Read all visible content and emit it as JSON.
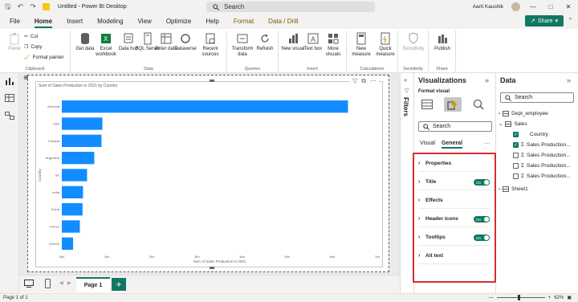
{
  "titlebar": {
    "doc_title": "Untitled - Power BI Desktop",
    "search_placeholder": "Search",
    "user_name": "Aarti Kaushik"
  },
  "menu": {
    "tabs": [
      "File",
      "Home",
      "Insert",
      "Modeling",
      "View",
      "Optimize",
      "Help",
      "Format",
      "Data / Drill"
    ],
    "active": "Home",
    "share_label": "Share"
  },
  "ribbon": {
    "clipboard": {
      "paste": "Paste",
      "cut": "Cut",
      "copy": "Copy",
      "format_painter": "Format painter",
      "group": "Clipboard"
    },
    "data": {
      "get_data": "Get data",
      "excel": "Excel workbook",
      "data_hub": "Data hub",
      "sql": "SQL Server",
      "enter_data": "Enter data",
      "dataverse": "Dataverse",
      "recent": "Recent sources",
      "group": "Data"
    },
    "queries": {
      "transform": "Transform data",
      "refresh": "Refresh",
      "group": "Queries"
    },
    "insert": {
      "new_visual": "New visual",
      "text_box": "Text box",
      "more_visuals": "More visuals",
      "group": "Insert"
    },
    "calculations": {
      "new_measure": "New measure",
      "quick_measure": "Quick measure",
      "group": "Calculations"
    },
    "sensitivity": {
      "label": "Sensitivity",
      "group": "Sensitivity"
    },
    "share": {
      "publish": "Publish",
      "group": "Share"
    }
  },
  "chart_data": {
    "type": "bar",
    "title": "Sum of Sales Production in 2021 by Country",
    "xlabel": "Sum of Sales Production in 2021",
    "ylabel": "Country",
    "categories": [
      "Armenia",
      "USA",
      "Canada",
      "Argentina",
      "UK",
      "India",
      "China",
      "France",
      "Greece"
    ],
    "values": [
      6.35,
      0.9,
      0.88,
      0.72,
      0.56,
      0.47,
      0.46,
      0.4,
      0.25
    ],
    "xlim": [
      0,
      7
    ],
    "xticks": [
      "0bn",
      "1bn",
      "2bn",
      "3bn",
      "4bn",
      "5bn",
      "6bn",
      "7bn"
    ],
    "bar_color": "#118DFF"
  },
  "pages": {
    "tab": "Page 1",
    "add": "+"
  },
  "status": {
    "page_info": "Page 1 of 1",
    "zoom": "62%"
  },
  "filters": {
    "label": "Filters"
  },
  "viz_pane": {
    "title": "Visualizations",
    "format_visual": "Format visual",
    "search_placeholder": "Search",
    "tabs": [
      "Visual",
      "General"
    ],
    "active_tab": "General",
    "more": "···",
    "cards": [
      {
        "label": "Properties",
        "toggle": ""
      },
      {
        "label": "Title",
        "toggle": "On"
      },
      {
        "label": "Effects",
        "toggle": ""
      },
      {
        "label": "Header icons",
        "toggle": "On"
      },
      {
        "label": "Tooltips",
        "toggle": "On"
      },
      {
        "label": "Alt text",
        "toggle": ""
      }
    ]
  },
  "data_pane": {
    "title": "Data",
    "search_placeholder": "Search",
    "items": [
      {
        "label": "Dept_employee",
        "kind": "table",
        "expanded": false,
        "checked": false
      },
      {
        "label": "Sales",
        "kind": "table",
        "expanded": true,
        "checked": false
      },
      {
        "label": "Country",
        "kind": "field",
        "checked": true
      },
      {
        "label": "Sales Production...",
        "kind": "measure",
        "checked": true
      },
      {
        "label": "Sales Production...",
        "kind": "measure",
        "checked": false
      },
      {
        "label": "Sales Production...",
        "kind": "measure",
        "checked": false
      },
      {
        "label": "Sales Production...",
        "kind": "measure",
        "checked": false
      },
      {
        "label": "Sheet1",
        "kind": "table",
        "expanded": false,
        "checked": false
      }
    ]
  }
}
